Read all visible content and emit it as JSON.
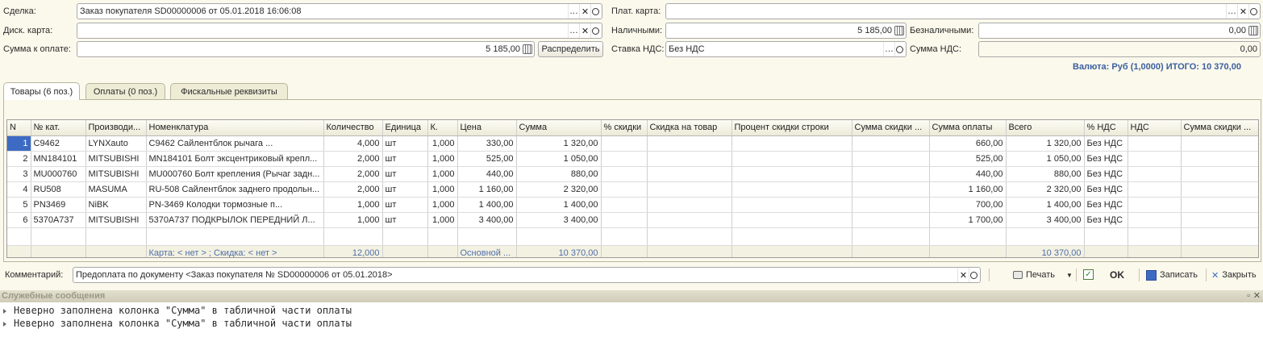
{
  "header": {
    "deal_label": "Сделка:",
    "deal_value": "Заказ покупателя SD00000006 от 05.01.2018 16:06:08",
    "disc_card_label": "Диск. карта:",
    "disc_card_value": "",
    "amount_label": "Сумма к оплате:",
    "amount_value": "5 185,00",
    "distribute_label": "Распределить",
    "pay_card_label": "Плат. карта:",
    "pay_card_value": "",
    "cash_label": "Наличными:",
    "cash_value": "5 185,00",
    "cashless_label": "Безналичными:",
    "cashless_value": "0,00",
    "vat_rate_label": "Ставка НДС:",
    "vat_rate_value": "Без НДС",
    "vat_sum_label": "Сумма НДС:",
    "vat_sum_value": "0,00",
    "currency_total": "Валюта: Руб (1,0000) ИТОГО: 10 370,00"
  },
  "tabs": [
    {
      "label": "Товары (6 поз.)"
    },
    {
      "label": "Оплаты (0 поз.)"
    },
    {
      "label": "Фискальные реквизиты"
    }
  ],
  "table": {
    "columns": [
      "N",
      "№ кат.",
      "Производи...",
      "Номенклатура",
      "Количество",
      "Единица",
      "К.",
      "Цена",
      "Сумма",
      "% скидки",
      "Скидка на товар",
      "Процент скидки строки",
      "Сумма скидки ...",
      "Сумма оплаты",
      "Всего",
      "% НДС",
      "НДС",
      "Сумма скидки ..."
    ],
    "rows": [
      [
        "1",
        "C9462",
        "LYNXauto",
        "C9462                  Сайлентблок рычага ...",
        "4,000",
        "шт",
        "1,000",
        "330,00",
        "1 320,00",
        "",
        "",
        "",
        "",
        "660,00",
        "1 320,00",
        "Без НДС",
        "",
        ""
      ],
      [
        "2",
        "MN184101",
        "MITSUBISHI",
        "MN184101 Болт эксцентриковый крепл...",
        "2,000",
        "шт",
        "1,000",
        "525,00",
        "1 050,00",
        "",
        "",
        "",
        "",
        "525,00",
        "1 050,00",
        "Без НДС",
        "",
        ""
      ],
      [
        "3",
        "MU000760",
        "MITSUBISHI",
        "MU000760 Болт крепления (Рычаг задн...",
        "2,000",
        "шт",
        "1,000",
        "440,00",
        "880,00",
        "",
        "",
        "",
        "",
        "440,00",
        "880,00",
        "Без НДС",
        "",
        ""
      ],
      [
        "4",
        "RU508",
        "MASUMA",
        "RU-508 Сайлентблок заднего продольн...",
        "2,000",
        "шт",
        "1,000",
        "1 160,00",
        "2 320,00",
        "",
        "",
        "",
        "",
        "1 160,00",
        "2 320,00",
        "Без НДС",
        "",
        ""
      ],
      [
        "5",
        "PN3469",
        "NiBK",
        "PN-3469                  Колодки тормозные п...",
        "1,000",
        "шт",
        "1,000",
        "1 400,00",
        "1 400,00",
        "",
        "",
        "",
        "",
        "700,00",
        "1 400,00",
        "Без НДС",
        "",
        ""
      ],
      [
        "6",
        "5370A737",
        "MITSUBISHI",
        "5370A737 ПОДКРЫЛОК ПЕРЕДНИЙ Л...",
        "1,000",
        "шт",
        "1,000",
        "3 400,00",
        "3 400,00",
        "",
        "",
        "",
        "",
        "1 700,00",
        "3 400,00",
        "Без НДС",
        "",
        ""
      ]
    ],
    "footer": [
      "",
      "",
      "",
      "Карта: < нет > ; Скидка: < нет >",
      "12,000",
      "",
      "",
      "Основной ...",
      "10 370,00",
      "",
      "",
      "",
      "",
      "",
      "10 370,00",
      "",
      "",
      ""
    ]
  },
  "bottom": {
    "comment_label": "Комментарий:",
    "comment_value": "Предоплата по документу <Заказ покупателя № SD00000006 от 05.01.2018>",
    "print_label": "Печать",
    "ok_label": "OK",
    "save_label": "Записать",
    "close_label": "Закрыть"
  },
  "messages": {
    "header": "Служебные сообщения",
    "lines": [
      "Неверно заполнена колонка \"Сумма\" в табличной части оплаты",
      "Неверно заполнена колонка \"Сумма\" в табличной части оплаты"
    ]
  }
}
